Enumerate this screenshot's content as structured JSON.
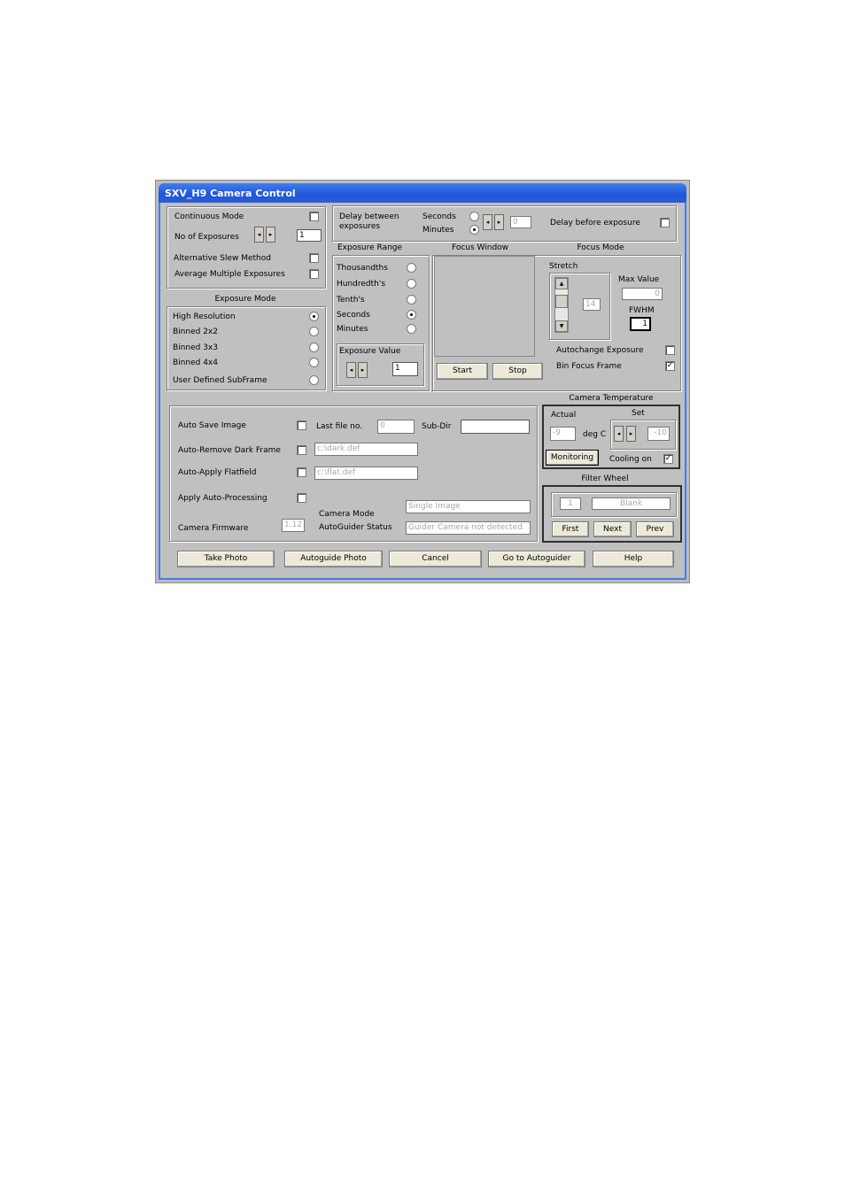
{
  "window": {
    "title": "SXV_H9 Camera Control"
  },
  "top_left": {
    "continuous_mode": "Continuous Mode",
    "no_of_exposures": "No of Exposures",
    "no_of_exposures_value": "1",
    "alt_slew": "Alternative Slew Method",
    "avg_multi": "Average Multiple Exposures"
  },
  "exposure_mode": {
    "title": "Exposure Mode",
    "options": [
      "High Resolution",
      "Binned 2x2",
      "Binned 3x3",
      "Binned 4x4",
      "User Defined SubFrame"
    ],
    "selected": "High Resolution"
  },
  "delay": {
    "label": "Delay between exposures",
    "seconds": "Seconds",
    "minutes": "Minutes",
    "selected": "Minutes",
    "value": "0",
    "before_label": "Delay before exposure"
  },
  "exposure_range": {
    "title": "Exposure Range",
    "options": [
      "Thousandths",
      "Hundredth's",
      "Tenth's",
      "Seconds",
      "Minutes"
    ],
    "selected": "Seconds",
    "value_title": "Exposure Value",
    "value": "1"
  },
  "focus_window": {
    "title": "Focus Window",
    "start": "Start",
    "stop": "Stop"
  },
  "focus_mode": {
    "title": "Focus Mode",
    "stretch": "Stretch",
    "stretch_value": "14",
    "max_value_label": "Max Value",
    "max_value": "0",
    "fwhm_label": "FWHM",
    "fwhm_value": "1",
    "autochange": "Autochange Exposure",
    "bin_focus": "Bin Focus Frame"
  },
  "save": {
    "auto_save": "Auto Save Image",
    "last_file_label": "Last file no.",
    "last_file_value": "0",
    "subdir_label": "Sub-Dir",
    "subdir_value": "",
    "auto_remove_dark": "Auto-Remove Dark Frame",
    "dark_file": "c:\\dark.def",
    "auto_flat": "Auto-Apply Flatfield",
    "flat_file": "c:\\flat.def",
    "auto_processing": "Apply Auto-Processing",
    "camera_mode_label": "Camera Mode",
    "camera_mode_value": "Single Image",
    "firmware_label": "Camera Firmware",
    "firmware_value": "1.12",
    "autoguider_label": "AutoGuider Status",
    "autoguider_value": "Guider Camera not detected"
  },
  "temperature": {
    "title": "Camera Temperature",
    "actual_label": "Actual",
    "actual_value": "-9",
    "unit": "deg C",
    "set_label": "Set",
    "set_value": "-10",
    "monitoring": "Monitoring",
    "cooling_on": "Cooling on"
  },
  "filter_wheel": {
    "title": "Filter Wheel",
    "position": "1",
    "name": "Blank",
    "first": "First",
    "next": "Next",
    "prev": "Prev"
  },
  "bottom_buttons": [
    "Take Photo",
    "Autoguide Photo",
    "Cancel",
    "Go to Autoguider",
    "Help"
  ],
  "icons": {
    "check": "✓",
    "arrow_left": "◂",
    "arrow_right": "▸",
    "arrow_up": "▲",
    "arrow_down": "▼"
  }
}
